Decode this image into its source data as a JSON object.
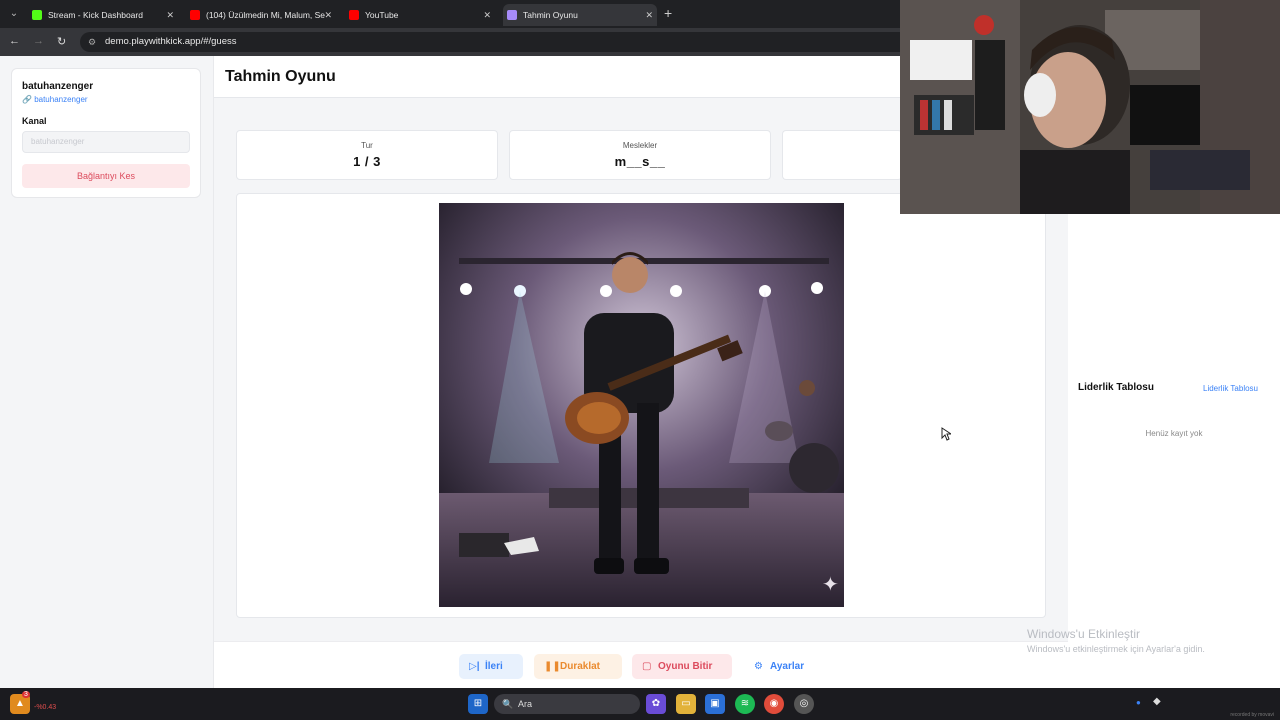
{
  "browser": {
    "tabs": [
      {
        "title": "Stream - Kick Dashboard",
        "color": "#53fc18"
      },
      {
        "title": "(104) Üzülmedin Mi, Malum, Se",
        "color": "#ff0000"
      },
      {
        "title": "YouTube",
        "color": "#ff0000"
      },
      {
        "title": "Tahmin Oyunu",
        "color": "#a78bfa"
      }
    ],
    "url": "demo.playwithkick.app/#/guess"
  },
  "sidebar": {
    "username": "batuhanzenger",
    "user_link": "batuhanzenger",
    "kanal_label": "Kanal",
    "kanal_placeholder": "batuhanzenger",
    "disconnect_label": "Bağlantıyı Kes"
  },
  "header": {
    "title": "Tahmin Oyunu"
  },
  "stats": [
    {
      "label": "Tur",
      "value": "1 / 3"
    },
    {
      "label": "Meslekler",
      "value": "m__s__"
    }
  ],
  "controls": {
    "next_label": "İleri",
    "pause_label": "Duraklat",
    "end_label": "Oyunu Bitir",
    "settings_label": "Ayarlar"
  },
  "leaderboard": {
    "title": "Liderlik Tablosu",
    "link": "Liderlik Tablosu",
    "empty": "Henüz kayıt yok"
  },
  "watermark": {
    "line1": "Windows'u Etkinleştir",
    "line2": "Windows'u etkinleştirmek için Ayarlar'a gidin."
  },
  "taskbar": {
    "search_placeholder": "Ara",
    "stock_change": "-%0.43",
    "notification_count": "3",
    "recorded": "recorded by movavi"
  },
  "colors": {
    "accent_blue": "#3b82f6",
    "danger": "#dc4b5d",
    "warning": "#ea8a2e"
  }
}
